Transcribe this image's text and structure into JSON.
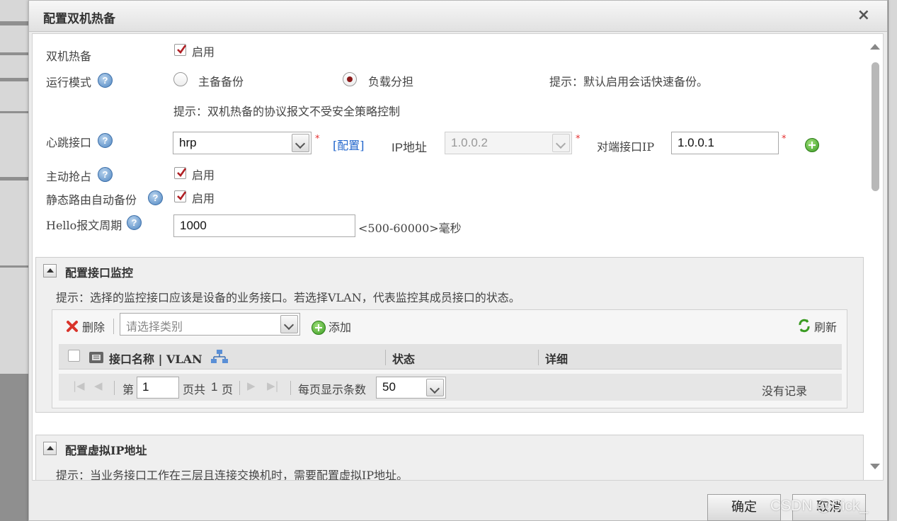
{
  "dialog": {
    "title": "配置双机热备",
    "close_symbol": "×"
  },
  "form": {
    "hot_standby": {
      "label": "双机热备",
      "checkbox_label": "启用",
      "checked": true
    },
    "run_mode": {
      "label": "运行模式",
      "options": [
        {
          "label": "主备备份",
          "selected": false
        },
        {
          "label": "负载分担",
          "selected": true
        }
      ],
      "hint": "提示：默认启用会话快速备份。"
    },
    "protocol_hint": "提示：双机热备的协议报文不受安全策略控制",
    "heartbeat": {
      "label": "心跳接口",
      "interface_value": "hrp",
      "required_mark": "*",
      "config_link": "[配置]",
      "ip_label": "IP地址",
      "ip_value": "1.0.0.2",
      "peer_ip_label": "对端接口IP",
      "peer_ip_value": "1.0.0.1"
    },
    "preempt": {
      "label": "主动抢占",
      "checkbox_label": "启用",
      "checked": true
    },
    "static_route_backup": {
      "label": "静态路由自动备份",
      "checkbox_label": "启用",
      "checked": true
    },
    "hello": {
      "label": "Hello报文周期",
      "value": "1000",
      "range_hint": "<500-60000>毫秒"
    }
  },
  "monitor_panel": {
    "title": "配置接口监控",
    "hint": "提示：选择的监控接口应该是设备的业务接口。若选择VLAN，代表监控其成员接口的状态。",
    "toolbar": {
      "delete_label": "删除",
      "category_placeholder": "请选择类别",
      "add_label": "添加",
      "refresh_label": "刷新"
    },
    "columns": [
      "接口名称 | VLAN",
      "状态",
      "详细"
    ],
    "pager": {
      "page_prefix": "第",
      "page_value": "1",
      "page_suffix": "页共",
      "total_pages": "1",
      "page_unit": "页",
      "per_page_label": "每页显示条数",
      "per_page_value": "50",
      "empty_text": "没有记录"
    }
  },
  "vip_panel": {
    "title": "配置虚拟IP地址",
    "hint": "提示：当业务接口工作在三层且连接交换机时，需要配置虚拟IP地址。"
  },
  "footer": {
    "ok_label": "确定",
    "cancel_label": "取消"
  },
  "watermark": "CSDN @Sick_",
  "colors": {
    "link": "#2266cc",
    "required": "#e53030",
    "radio_selected": "#8b1a1a",
    "checkmark": "#b01f24",
    "add_green": "#3a9b22"
  }
}
